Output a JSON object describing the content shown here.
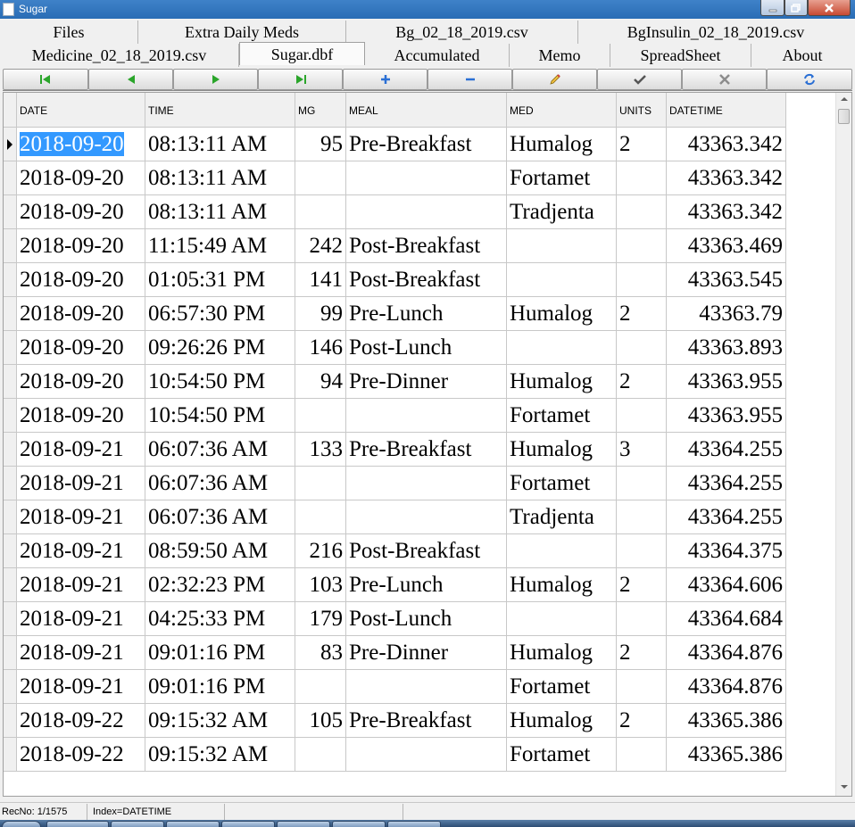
{
  "window": {
    "title": "Sugar"
  },
  "tabs": {
    "row1": [
      "Files",
      "Extra Daily Meds",
      "Bg_02_18_2019.csv",
      "BgInsulin_02_18_2019.csv"
    ],
    "row2": [
      "Medicine_02_18_2019.csv",
      "Sugar.dbf",
      "Accumulated",
      "Memo",
      "SpreadSheet",
      "About"
    ],
    "active": "Sugar.dbf"
  },
  "navigator": {
    "buttons": [
      "first-record",
      "prior-record",
      "next-record",
      "last-record",
      "insert-record",
      "delete-record",
      "edit-record",
      "post-edit",
      "cancel-edit",
      "refresh-data"
    ],
    "colors": {
      "green": "#2aa52a",
      "blue": "#2a6fd4",
      "gray": "#8c8c8c",
      "dark": "#555555"
    }
  },
  "grid": {
    "columns": [
      "DATE",
      "TIME",
      "MG",
      "MEAL",
      "MED",
      "UNITS",
      "DATETIME"
    ],
    "selection_color": "#3399ff",
    "rows": [
      [
        "2018-09-20",
        "08:13:11 AM",
        "95",
        "Pre-Breakfast",
        "Humalog",
        "2",
        "43363.342"
      ],
      [
        "2018-09-20",
        "08:13:11 AM",
        "",
        "",
        "Fortamet",
        "",
        "43363.342"
      ],
      [
        "2018-09-20",
        "08:13:11 AM",
        "",
        "",
        "Tradjenta",
        "",
        "43363.342"
      ],
      [
        "2018-09-20",
        "11:15:49 AM",
        "242",
        "Post-Breakfast",
        "",
        "",
        "43363.469"
      ],
      [
        "2018-09-20",
        "01:05:31 PM",
        "141",
        "Post-Breakfast",
        "",
        "",
        "43363.545"
      ],
      [
        "2018-09-20",
        "06:57:30 PM",
        "99",
        "Pre-Lunch",
        "Humalog",
        "2",
        "43363.79"
      ],
      [
        "2018-09-20",
        "09:26:26 PM",
        "146",
        "Post-Lunch",
        "",
        "",
        "43363.893"
      ],
      [
        "2018-09-20",
        "10:54:50 PM",
        "94",
        "Pre-Dinner",
        "Humalog",
        "2",
        "43363.955"
      ],
      [
        "2018-09-20",
        "10:54:50 PM",
        "",
        "",
        "Fortamet",
        "",
        "43363.955"
      ],
      [
        "2018-09-21",
        "06:07:36 AM",
        "133",
        "Pre-Breakfast",
        "Humalog",
        "3",
        "43364.255"
      ],
      [
        "2018-09-21",
        "06:07:36 AM",
        "",
        "",
        "Fortamet",
        "",
        "43364.255"
      ],
      [
        "2018-09-21",
        "06:07:36 AM",
        "",
        "",
        "Tradjenta",
        "",
        "43364.255"
      ],
      [
        "2018-09-21",
        "08:59:50 AM",
        "216",
        "Post-Breakfast",
        "",
        "",
        "43364.375"
      ],
      [
        "2018-09-21",
        "02:32:23 PM",
        "103",
        "Pre-Lunch",
        "Humalog",
        "2",
        "43364.606"
      ],
      [
        "2018-09-21",
        "04:25:33 PM",
        "179",
        "Post-Lunch",
        "",
        "",
        "43364.684"
      ],
      [
        "2018-09-21",
        "09:01:16 PM",
        "83",
        "Pre-Dinner",
        "Humalog",
        "2",
        "43364.876"
      ],
      [
        "2018-09-21",
        "09:01:16 PM",
        "",
        "",
        "Fortamet",
        "",
        "43364.876"
      ],
      [
        "2018-09-22",
        "09:15:32 AM",
        "105",
        "Pre-Breakfast",
        "Humalog",
        "2",
        "43365.386"
      ],
      [
        "2018-09-22",
        "09:15:32 AM",
        "",
        "",
        "Fortamet",
        "",
        "43365.386"
      ]
    ]
  },
  "status": {
    "recno": "RecNo: 1/1575",
    "index": "Index=DATETIME"
  }
}
